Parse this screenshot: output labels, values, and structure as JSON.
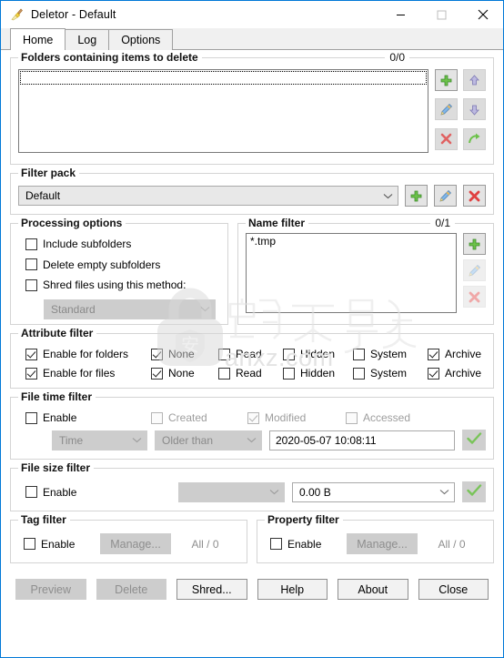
{
  "window": {
    "title": "Deletor - Default",
    "icon": "broom-icon",
    "border_color": "#0078d7",
    "caption": {
      "minimize": "—",
      "maximize": "□",
      "close": "✕"
    }
  },
  "tabs": [
    {
      "label": "Home",
      "active": true
    },
    {
      "label": "Log",
      "active": false
    },
    {
      "label": "Options",
      "active": false
    }
  ],
  "folders_group": {
    "legend": "Folders containing items to delete",
    "counter": "0/0",
    "items": [],
    "buttons": [
      {
        "name": "add-folder-button",
        "icon": "plus-icon",
        "enabled": true
      },
      {
        "name": "move-folder-up-button",
        "icon": "arrow-up-icon",
        "enabled": false
      },
      {
        "name": "edit-folder-button",
        "icon": "pencil-icon",
        "enabled": false
      },
      {
        "name": "move-folder-down-button",
        "icon": "arrow-down-icon",
        "enabled": false
      },
      {
        "name": "remove-folder-button",
        "icon": "red-x-icon",
        "enabled": false
      },
      {
        "name": "open-folder-button",
        "icon": "green-arrow-icon",
        "enabled": false
      }
    ]
  },
  "filter_pack": {
    "legend": "Filter pack",
    "selected": "Default",
    "buttons": [
      {
        "name": "add-filter-pack-button",
        "icon": "plus-icon"
      },
      {
        "name": "edit-filter-pack-button",
        "icon": "pencil-icon"
      },
      {
        "name": "delete-filter-pack-button",
        "icon": "red-x-icon"
      }
    ]
  },
  "processing_options": {
    "legend": "Processing options",
    "include_subfolders": {
      "label": "Include subfolders",
      "checked": false
    },
    "delete_empty_subfolders": {
      "label": "Delete empty subfolders",
      "checked": false
    },
    "shred_files": {
      "label": "Shred files using this method:",
      "checked": false
    },
    "shred_method": "Standard"
  },
  "name_filter": {
    "legend": "Name filter",
    "counter": "0/1",
    "items": [
      "*.tmp"
    ],
    "buttons": [
      {
        "name": "add-name-filter-button",
        "icon": "plus-icon",
        "enabled": true
      },
      {
        "name": "edit-name-filter-button",
        "icon": "pencil-icon",
        "enabled": false
      },
      {
        "name": "remove-name-filter-button",
        "icon": "red-x-icon",
        "enabled": false
      }
    ]
  },
  "attribute_filter": {
    "legend": "Attribute filter",
    "rows": [
      {
        "enable": {
          "label": "Enable for folders",
          "checked": true
        },
        "none": {
          "label": "None",
          "checked": true
        },
        "read": {
          "label": "Read",
          "checked": false
        },
        "hidden": {
          "label": "Hidden",
          "checked": false
        },
        "system": {
          "label": "System",
          "checked": false
        },
        "archive": {
          "label": "Archive",
          "checked": true
        }
      },
      {
        "enable": {
          "label": "Enable for files",
          "checked": true
        },
        "none": {
          "label": "None",
          "checked": true
        },
        "read": {
          "label": "Read",
          "checked": false
        },
        "hidden": {
          "label": "Hidden",
          "checked": false
        },
        "system": {
          "label": "System",
          "checked": false
        },
        "archive": {
          "label": "Archive",
          "checked": true
        }
      }
    ]
  },
  "file_time_filter": {
    "legend": "File time filter",
    "enable": {
      "label": "Enable",
      "checked": false
    },
    "created": {
      "label": "Created",
      "checked": false
    },
    "modified": {
      "label": "Modified",
      "checked": true
    },
    "accessed": {
      "label": "Accessed",
      "checked": false
    },
    "mode": "Time",
    "comparison": "Older than",
    "value": "2020-05-07 10:08:11",
    "apply_icon": "green-check-icon"
  },
  "file_size_filter": {
    "legend": "File size filter",
    "enable": {
      "label": "Enable",
      "checked": false
    },
    "unit": "",
    "value": "0.00 B",
    "apply_icon": "green-check-icon"
  },
  "tag_filter": {
    "legend": "Tag filter",
    "enable": {
      "label": "Enable",
      "checked": false
    },
    "manage_label": "Manage...",
    "count": "All / 0"
  },
  "property_filter": {
    "legend": "Property filter",
    "enable": {
      "label": "Enable",
      "checked": false
    },
    "manage_label": "Manage...",
    "count": "All / 0"
  },
  "footer": {
    "preview": {
      "label": "Preview",
      "enabled": false
    },
    "delete": {
      "label": "Delete",
      "enabled": false
    },
    "shred": {
      "label": "Shred...",
      "enabled": true
    },
    "help": {
      "label": "Help",
      "enabled": true
    },
    "about": {
      "label": "About",
      "enabled": true
    },
    "close": {
      "label": "Close",
      "enabled": true
    }
  },
  "watermark": {
    "site": "anxz.com",
    "cn_text": "软下载",
    "color": "#e3e3e3"
  }
}
